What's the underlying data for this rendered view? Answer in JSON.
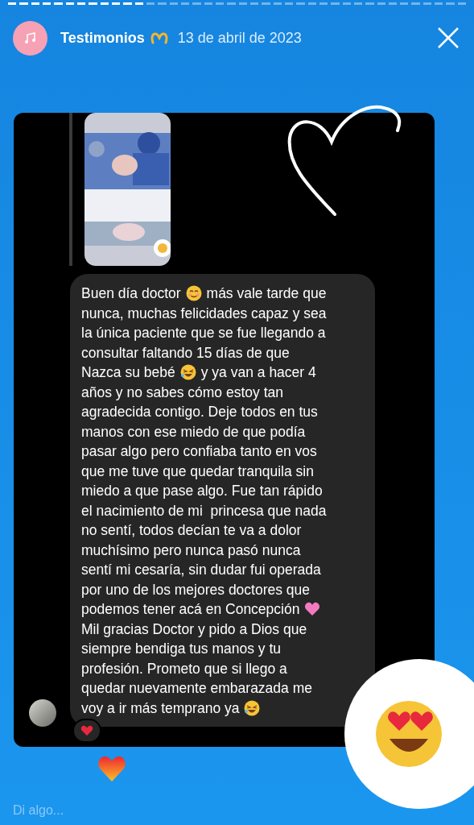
{
  "story_progress": {
    "level": 0.31
  },
  "header": {
    "title": "Testimonios",
    "date": "13 de abril de 2023"
  },
  "message_lines": [
    [
      {
        "kind": "text",
        "text": "Buen día doctor"
      },
      {
        "kind": "blush-emoji"
      },
      {
        "kind": "text",
        "text": "más vale tarde que"
      }
    ],
    [
      {
        "kind": "text",
        "text": "nunca, muchas felicidades capaz y sea"
      }
    ],
    [
      {
        "kind": "text",
        "text": "la única paciente que se fue llegando a"
      }
    ],
    [
      {
        "kind": "text",
        "text": "consultar faltando 15 días de que"
      }
    ],
    [
      {
        "kind": "text",
        "text": "Nazca su bebé"
      },
      {
        "kind": "laugh-emoji"
      },
      {
        "kind": "text",
        "text": "y ya van a hacer 4"
      }
    ],
    [
      {
        "kind": "text",
        "text": "años y no sabes cómo estoy tan"
      }
    ],
    [
      {
        "kind": "text",
        "text": "agradecida contigo. Deje todos en tus"
      }
    ],
    [
      {
        "kind": "text",
        "text": "manos con ese miedo de que podía"
      }
    ],
    [
      {
        "kind": "text",
        "text": "pasar algo pero confiaba tanto en vos"
      }
    ],
    [
      {
        "kind": "text",
        "text": "que me tuve que quedar tranquila sin"
      }
    ],
    [
      {
        "kind": "text",
        "text": "miedo a que pase algo. Fue tan rápido"
      }
    ],
    [
      {
        "kind": "text",
        "text": "el nacimiento de mi  princesa que nada"
      }
    ],
    [
      {
        "kind": "text",
        "text": "no sentí, todos decían te va a dolor"
      }
    ],
    [
      {
        "kind": "text",
        "text": "muchísimo pero nunca pasó nunca"
      }
    ],
    [
      {
        "kind": "text",
        "text": "sentí mi cesaría, sin dudar fui operada"
      }
    ],
    [
      {
        "kind": "text",
        "text": "por uno de los mejores doctores que"
      }
    ],
    [
      {
        "kind": "text",
        "text": "podemos tener acá en Concepción"
      },
      {
        "kind": "heart-emoji"
      }
    ],
    [
      {
        "kind": "text",
        "text": "Mil gracias Doctor y pido a Dios que"
      }
    ],
    [
      {
        "kind": "text",
        "text": "siempre bendiga tus manos y tu"
      }
    ],
    [
      {
        "kind": "text",
        "text": "profesión. Prometo que si llego a"
      }
    ],
    [
      {
        "kind": "text",
        "text": "quedar nuevamente embarazada me"
      }
    ],
    [
      {
        "kind": "text",
        "text": "voy a ir más temprano ya"
      },
      {
        "kind": "laugh-emoji"
      }
    ]
  ],
  "reply_field": {
    "placeholder": "Di algo..."
  }
}
